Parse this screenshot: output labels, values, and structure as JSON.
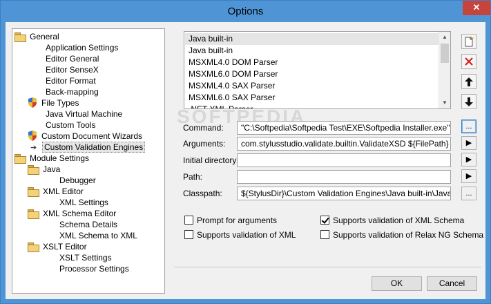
{
  "window": {
    "title": "Options",
    "close_glyph": "✕"
  },
  "tree": {
    "items": [
      {
        "label": "General",
        "icon": "folder-icon"
      },
      {
        "label": "Application Settings"
      },
      {
        "label": "Editor General"
      },
      {
        "label": "Editor SenseX"
      },
      {
        "label": "Editor Format"
      },
      {
        "label": "Back-mapping"
      },
      {
        "label": "File Types",
        "icon": "shield-icon"
      },
      {
        "label": "Java Virtual Machine"
      },
      {
        "label": "Custom Tools"
      },
      {
        "label": "Custom Document Wizards",
        "icon": "shield-icon"
      },
      {
        "label": "Custom Validation Engines",
        "icon": "arrow-icon",
        "selected": true
      },
      {
        "label": "Module Settings",
        "icon": "folder-icon"
      },
      {
        "label": "Java",
        "icon": "folder-icon"
      },
      {
        "label": "Debugger"
      },
      {
        "label": "XML Editor",
        "icon": "folder-icon"
      },
      {
        "label": "XML Settings"
      },
      {
        "label": "XML Schema Editor",
        "icon": "folder-icon"
      },
      {
        "label": "Schema Details"
      },
      {
        "label": "XML Schema to XML"
      },
      {
        "label": "XSLT Editor",
        "icon": "folder-icon"
      },
      {
        "label": "XSLT Settings"
      },
      {
        "label": "Processor Settings"
      }
    ]
  },
  "engines": {
    "rows": [
      "Java built-in",
      "Java built-in",
      "MSXML4.0 DOM Parser",
      "MSXML6.0 DOM Parser",
      "MSXML4.0 SAX Parser",
      "MSXML6.0 SAX Parser",
      ".NET XML Parser"
    ],
    "selected_index": 0
  },
  "watermark": "SOFTPEDIA",
  "fields": {
    "command": {
      "label": "Command:",
      "value": "\"C:\\Softpedia\\Softpedia Test\\EXE\\Softpedia Installer.exe\"",
      "button": "..."
    },
    "arguments": {
      "label": "Arguments:",
      "value": "com.stylusstudio.validate.builtin.ValidateXSD ${FilePath}",
      "button": "▶"
    },
    "initial_directory": {
      "label": "Initial directory:",
      "value": "",
      "button": "▶"
    },
    "path": {
      "label": "Path:",
      "value": "",
      "button": "▶"
    },
    "classpath": {
      "label": "Classpath:",
      "value": "${StylusDir}\\Custom Validation Engines\\Java built-in\\JavaBuiltin.jar",
      "button": "..."
    }
  },
  "checkboxes": {
    "prompt": {
      "label": "Prompt for arguments",
      "checked": false
    },
    "xml_schema": {
      "label": "Supports validation of XML Schema",
      "checked": true
    },
    "xml": {
      "label": "Supports validation of XML",
      "checked": false
    },
    "relax_ng": {
      "label": "Supports validation of Relax NG Schema",
      "checked": false
    }
  },
  "buttons": {
    "ok": "OK",
    "cancel": "Cancel"
  }
}
